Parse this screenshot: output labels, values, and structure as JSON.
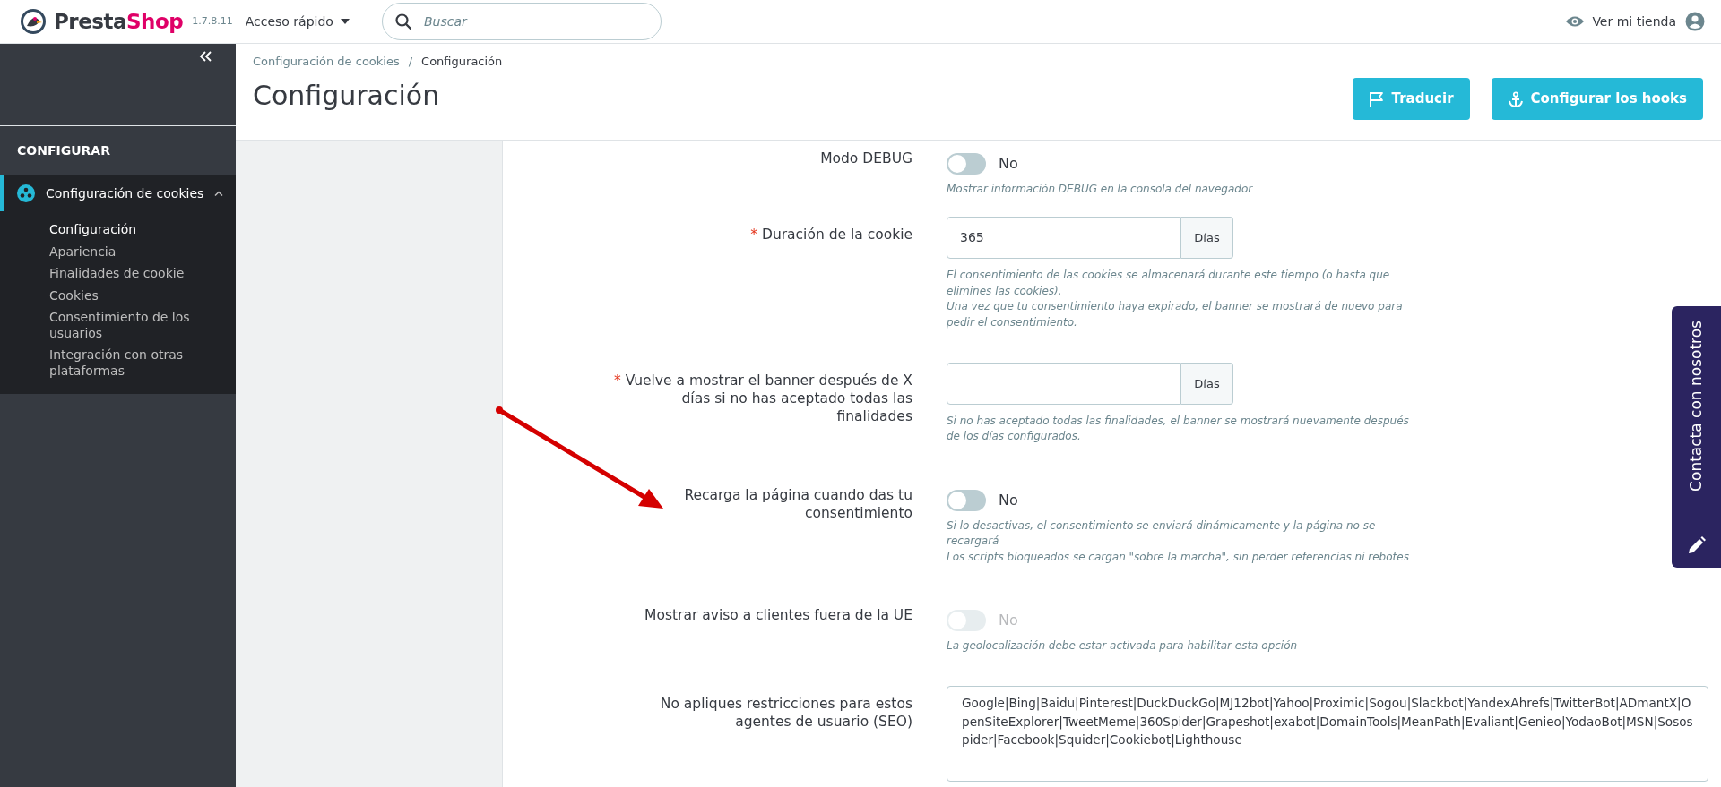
{
  "topbar": {
    "logo_parts": [
      "Presta",
      "Shop"
    ],
    "version": "1.7.8.11",
    "quick_access": "Acceso rápido",
    "search_placeholder": "Buscar",
    "view_store": "Ver mi tienda"
  },
  "sidebar": {
    "section": "CONFIGURAR",
    "menu": [
      {
        "label": "Configuración de cookies",
        "expanded": true,
        "selected": true,
        "children": [
          {
            "label": "Configuración",
            "selected": true
          },
          {
            "label": "Apariencia",
            "selected": false
          },
          {
            "label": "Finalidades de cookie",
            "selected": false
          },
          {
            "label": "Cookies",
            "selected": false
          },
          {
            "label": "Consentimiento de los usuarios",
            "selected": false
          },
          {
            "label": "Integración con otras plataformas",
            "selected": false
          }
        ]
      }
    ]
  },
  "header": {
    "breadcrumb": [
      "Configuración de cookies",
      "Configuración"
    ],
    "breadcrumb_separator": "/",
    "title": "Configuración",
    "buttons": [
      {
        "label": "Traducir"
      },
      {
        "label": "Configurar los hooks"
      }
    ]
  },
  "form": {
    "fields": [
      {
        "kind": "switch",
        "label": "Modo DEBUG",
        "on": false,
        "disabled": false,
        "value_label": "No",
        "help": [
          "Mostrar información DEBUG en la consola del navegador"
        ]
      },
      {
        "kind": "input",
        "required_mark": "*",
        "label": "Duración de la cookie",
        "value": "365",
        "addon": "Días",
        "help": [
          "El consentimiento de las cookies se almacenará durante este tiempo (o hasta que elimines las cookies).",
          "Una vez que tu consentimiento haya expirado, el banner se mostrará de nuevo para pedir el consentimiento."
        ]
      },
      {
        "kind": "input",
        "required_mark": "*",
        "label": "Vuelve a mostrar el banner después de X días si no has aceptado todas las finalidades",
        "addon": "Días",
        "help": [
          "Si no has aceptado todas las finalidades, el banner se mostrará nuevamente después de los días configurados."
        ]
      },
      {
        "kind": "switch",
        "label": "Recarga la página cuando das tu consentimiento",
        "on": false,
        "disabled": false,
        "value_label": "No",
        "help": [
          "Si lo desactivas, el consentimiento se enviará dinámicamente y la página no se recargará",
          "Los scripts bloqueados se cargan \"sobre la marcha\", sin perder referencias ni rebotes"
        ]
      },
      {
        "kind": "switch",
        "label": "Mostrar aviso a clientes fuera de la UE",
        "on": false,
        "disabled": true,
        "value_label": "No",
        "help": [
          "La geolocalización debe estar activada para habilitar esta opción"
        ]
      },
      {
        "kind": "textarea",
        "label": "No apliques restricciones para estos agentes de usuario (SEO)",
        "value": "Google|Bing|Baidu|Pinterest|DuckDuckGo|MJ12bot|Yahoo|Proximic|Sogou|Slackbot|YandexAhrefs|TwitterBot|ADmantX|OpenSiteExplorer|TweetMeme|360Spider|Grapeshot|exabot|DomainTools|MeanPath|Evaliant|Genieo|YodaoBot|MSN|Sosospider|Facebook|Squider|Cookiebot|Lighthouse"
      }
    ]
  },
  "contact_tab": {
    "label": "Contacta con nosotros"
  }
}
